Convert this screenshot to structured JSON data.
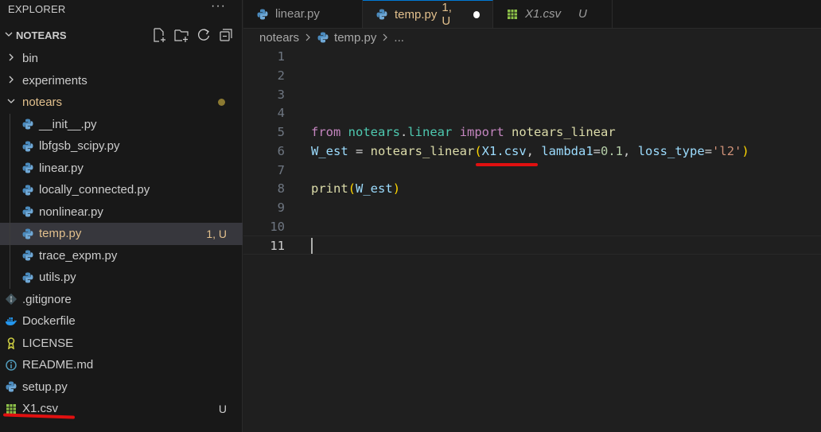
{
  "explorer": {
    "title": "EXPLORER",
    "more": "···",
    "section_title": "NOTEARS",
    "actions": [
      "new-file-icon",
      "new-folder-icon",
      "refresh-icon",
      "collapse-all-icon"
    ]
  },
  "tree": [
    {
      "label": "bin",
      "type": "folder",
      "expanded": false
    },
    {
      "label": "experiments",
      "type": "folder",
      "expanded": false
    },
    {
      "label": "notears",
      "type": "folder",
      "expanded": true,
      "modified": true
    },
    {
      "label": "__init__.py",
      "type": "python",
      "indent": 1
    },
    {
      "label": "lbfgsb_scipy.py",
      "type": "python",
      "indent": 1
    },
    {
      "label": "linear.py",
      "type": "python",
      "indent": 1
    },
    {
      "label": "locally_connected.py",
      "type": "python",
      "indent": 1
    },
    {
      "label": "nonlinear.py",
      "type": "python",
      "indent": 1
    },
    {
      "label": "temp.py",
      "type": "python",
      "indent": 1,
      "badge": "1, U",
      "selected": true
    },
    {
      "label": "trace_expm.py",
      "type": "python",
      "indent": 1
    },
    {
      "label": "utils.py",
      "type": "python",
      "indent": 1
    },
    {
      "label": ".gitignore",
      "type": "git"
    },
    {
      "label": "Dockerfile",
      "type": "docker"
    },
    {
      "label": "LICENSE",
      "type": "license"
    },
    {
      "label": "README.md",
      "type": "info"
    },
    {
      "label": "setup.py",
      "type": "python"
    },
    {
      "label": "X1.csv",
      "type": "csv",
      "badge": "U"
    }
  ],
  "tabs": [
    {
      "label": "linear.py",
      "icon": "python-icon"
    },
    {
      "label": "temp.py",
      "status": "1, U",
      "active": true,
      "unsaved": true,
      "icon": "python-icon"
    },
    {
      "label": "X1.csv",
      "status": "U",
      "italic": true,
      "icon": "csv-icon"
    }
  ],
  "breadcrumb": {
    "folder": "notears",
    "file": "temp.py",
    "more": "..."
  },
  "editor": {
    "line_numbers": [
      "1",
      "2",
      "3",
      "4",
      "5",
      "6",
      "7",
      "8",
      "9",
      "10",
      "11"
    ],
    "line5": {
      "from": "from",
      "module": "notears",
      "dot": ".",
      "submodule": "linear",
      "import": "import",
      "name": "notears_linear"
    },
    "line6": {
      "var": "W_est",
      "eq": " = ",
      "fn": "notears_linear",
      "open": "(",
      "arg1": "X1.csv",
      "comma1": ", ",
      "kw1": "lambda1",
      "eq1": "=",
      "val1": "0.1",
      "comma2": ", ",
      "kw2": "loss_type",
      "eq2": "=",
      "val2": "'l2'",
      "close": ")"
    },
    "line8": {
      "fn": "print",
      "open": "(",
      "arg": "W_est",
      "close": ")"
    }
  },
  "colors": {
    "accent": "#0078d4",
    "modified": "#e2c08d",
    "annotation": "#e01010"
  }
}
